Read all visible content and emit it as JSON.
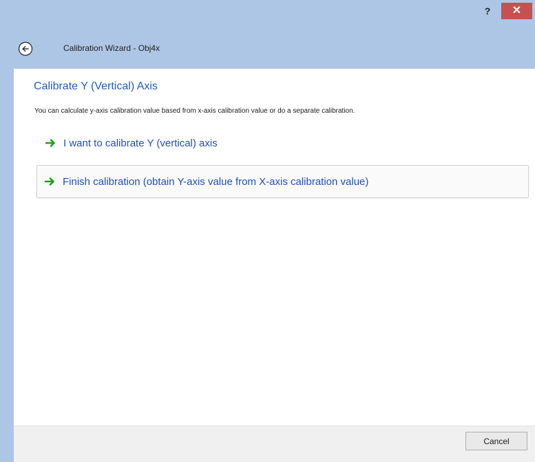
{
  "window": {
    "help_label": "?",
    "close_label": "✕",
    "title": "Calibration Wizard - Obj4x"
  },
  "page": {
    "heading": "Calibrate Y (Vertical) Axis",
    "description": "You can calculate y-axis calibration value based from x-axis calibration value or do a separate calibration.",
    "options": [
      {
        "label": "I want to calibrate Y (vertical) axis",
        "icon": "green-arrow-icon"
      },
      {
        "label": "Finish calibration (obtain Y-axis value from X-axis calibration value)",
        "icon": "green-arrow-icon"
      }
    ]
  },
  "footer": {
    "cancel_label": "Cancel"
  },
  "colors": {
    "titlebar": "#adc6e5",
    "close": "#c75050",
    "heading": "#1f5bc4",
    "command": "#1f4fb8",
    "arrow": "#1f9e1f"
  }
}
